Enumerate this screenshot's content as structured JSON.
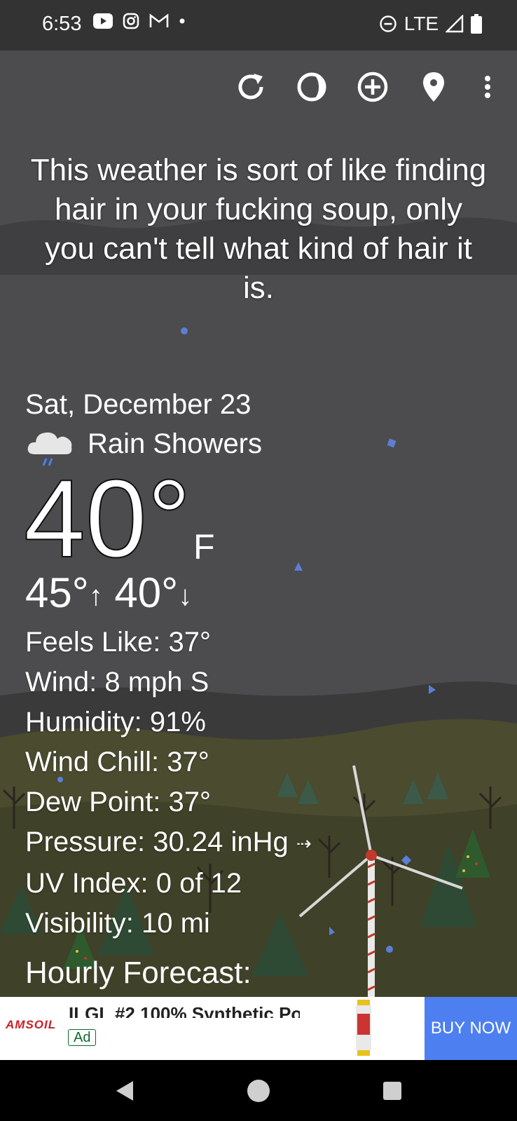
{
  "status_bar": {
    "time": "6:53",
    "network": "LTE"
  },
  "toolbar": {
    "icons": [
      "refresh-icon",
      "theme-icon",
      "add-location-icon",
      "location-pin-icon",
      "more-icon"
    ]
  },
  "quote": "This weather is sort of like finding hair in your fucking soup, only you can't tell what kind of hair it is.",
  "weather": {
    "date": "Sat, December 23",
    "condition": "Rain Showers",
    "temperature": "40°",
    "unit": "F",
    "high": "45°",
    "low": "40°",
    "details": [
      {
        "label": "Feels Like:",
        "value": "37°"
      },
      {
        "label": "Wind:",
        "value": "8 mph S"
      },
      {
        "label": "Humidity:",
        "value": "91%"
      },
      {
        "label": "Wind Chill:",
        "value": "37°"
      },
      {
        "label": "Dew Point:",
        "value": "37°"
      },
      {
        "label": "Pressure:",
        "value": "30.24 inHg"
      },
      {
        "label": "UV Index:",
        "value": "0 of 12"
      },
      {
        "label": "Visibility:",
        "value": "10 mi"
      }
    ]
  },
  "hourly_heading": "Hourly Forecast:",
  "ad": {
    "brand": "AMSOIL",
    "title": "ILGL #2 100% Synthetic Po",
    "badge": "Ad",
    "button": "BUY NOW"
  },
  "colors": {
    "status_bar": "#333334",
    "background": "#4c4c4e",
    "ad_button": "#4d7ff0"
  }
}
